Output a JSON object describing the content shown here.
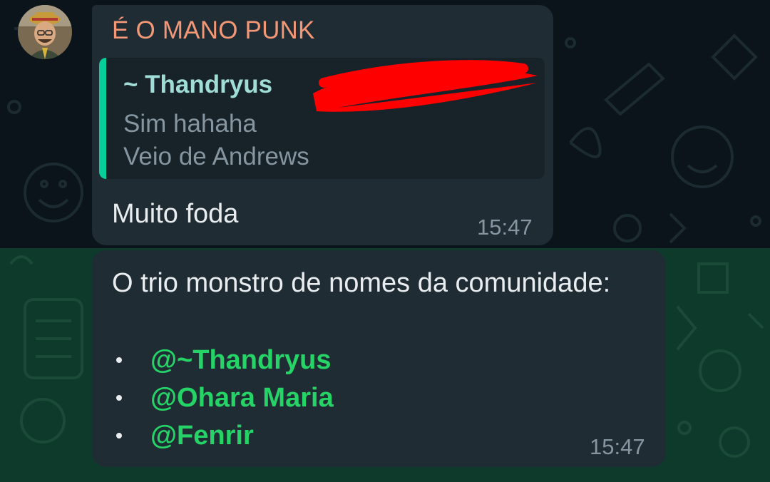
{
  "colors": {
    "top_background": "#0b141a",
    "bottom_background": "#0e3a2b",
    "bubble": "#1f2c34",
    "quote_accent": "#06cf9c",
    "sender_name": "#f29877",
    "mention": "#25d366"
  },
  "message1": {
    "sender": "É O MANO PUNK",
    "quoted": {
      "author": "~ Thandryus",
      "line1": "Sim hahaha",
      "line2": "Veio de Andrews"
    },
    "text": "Muito foda",
    "time": "15:47"
  },
  "message2": {
    "text": "O trio monstro de nomes da comunidade:",
    "mentions": [
      "@~Thandryus",
      "@Ohara Maria",
      "@Fenrir"
    ],
    "time": "15:47"
  }
}
